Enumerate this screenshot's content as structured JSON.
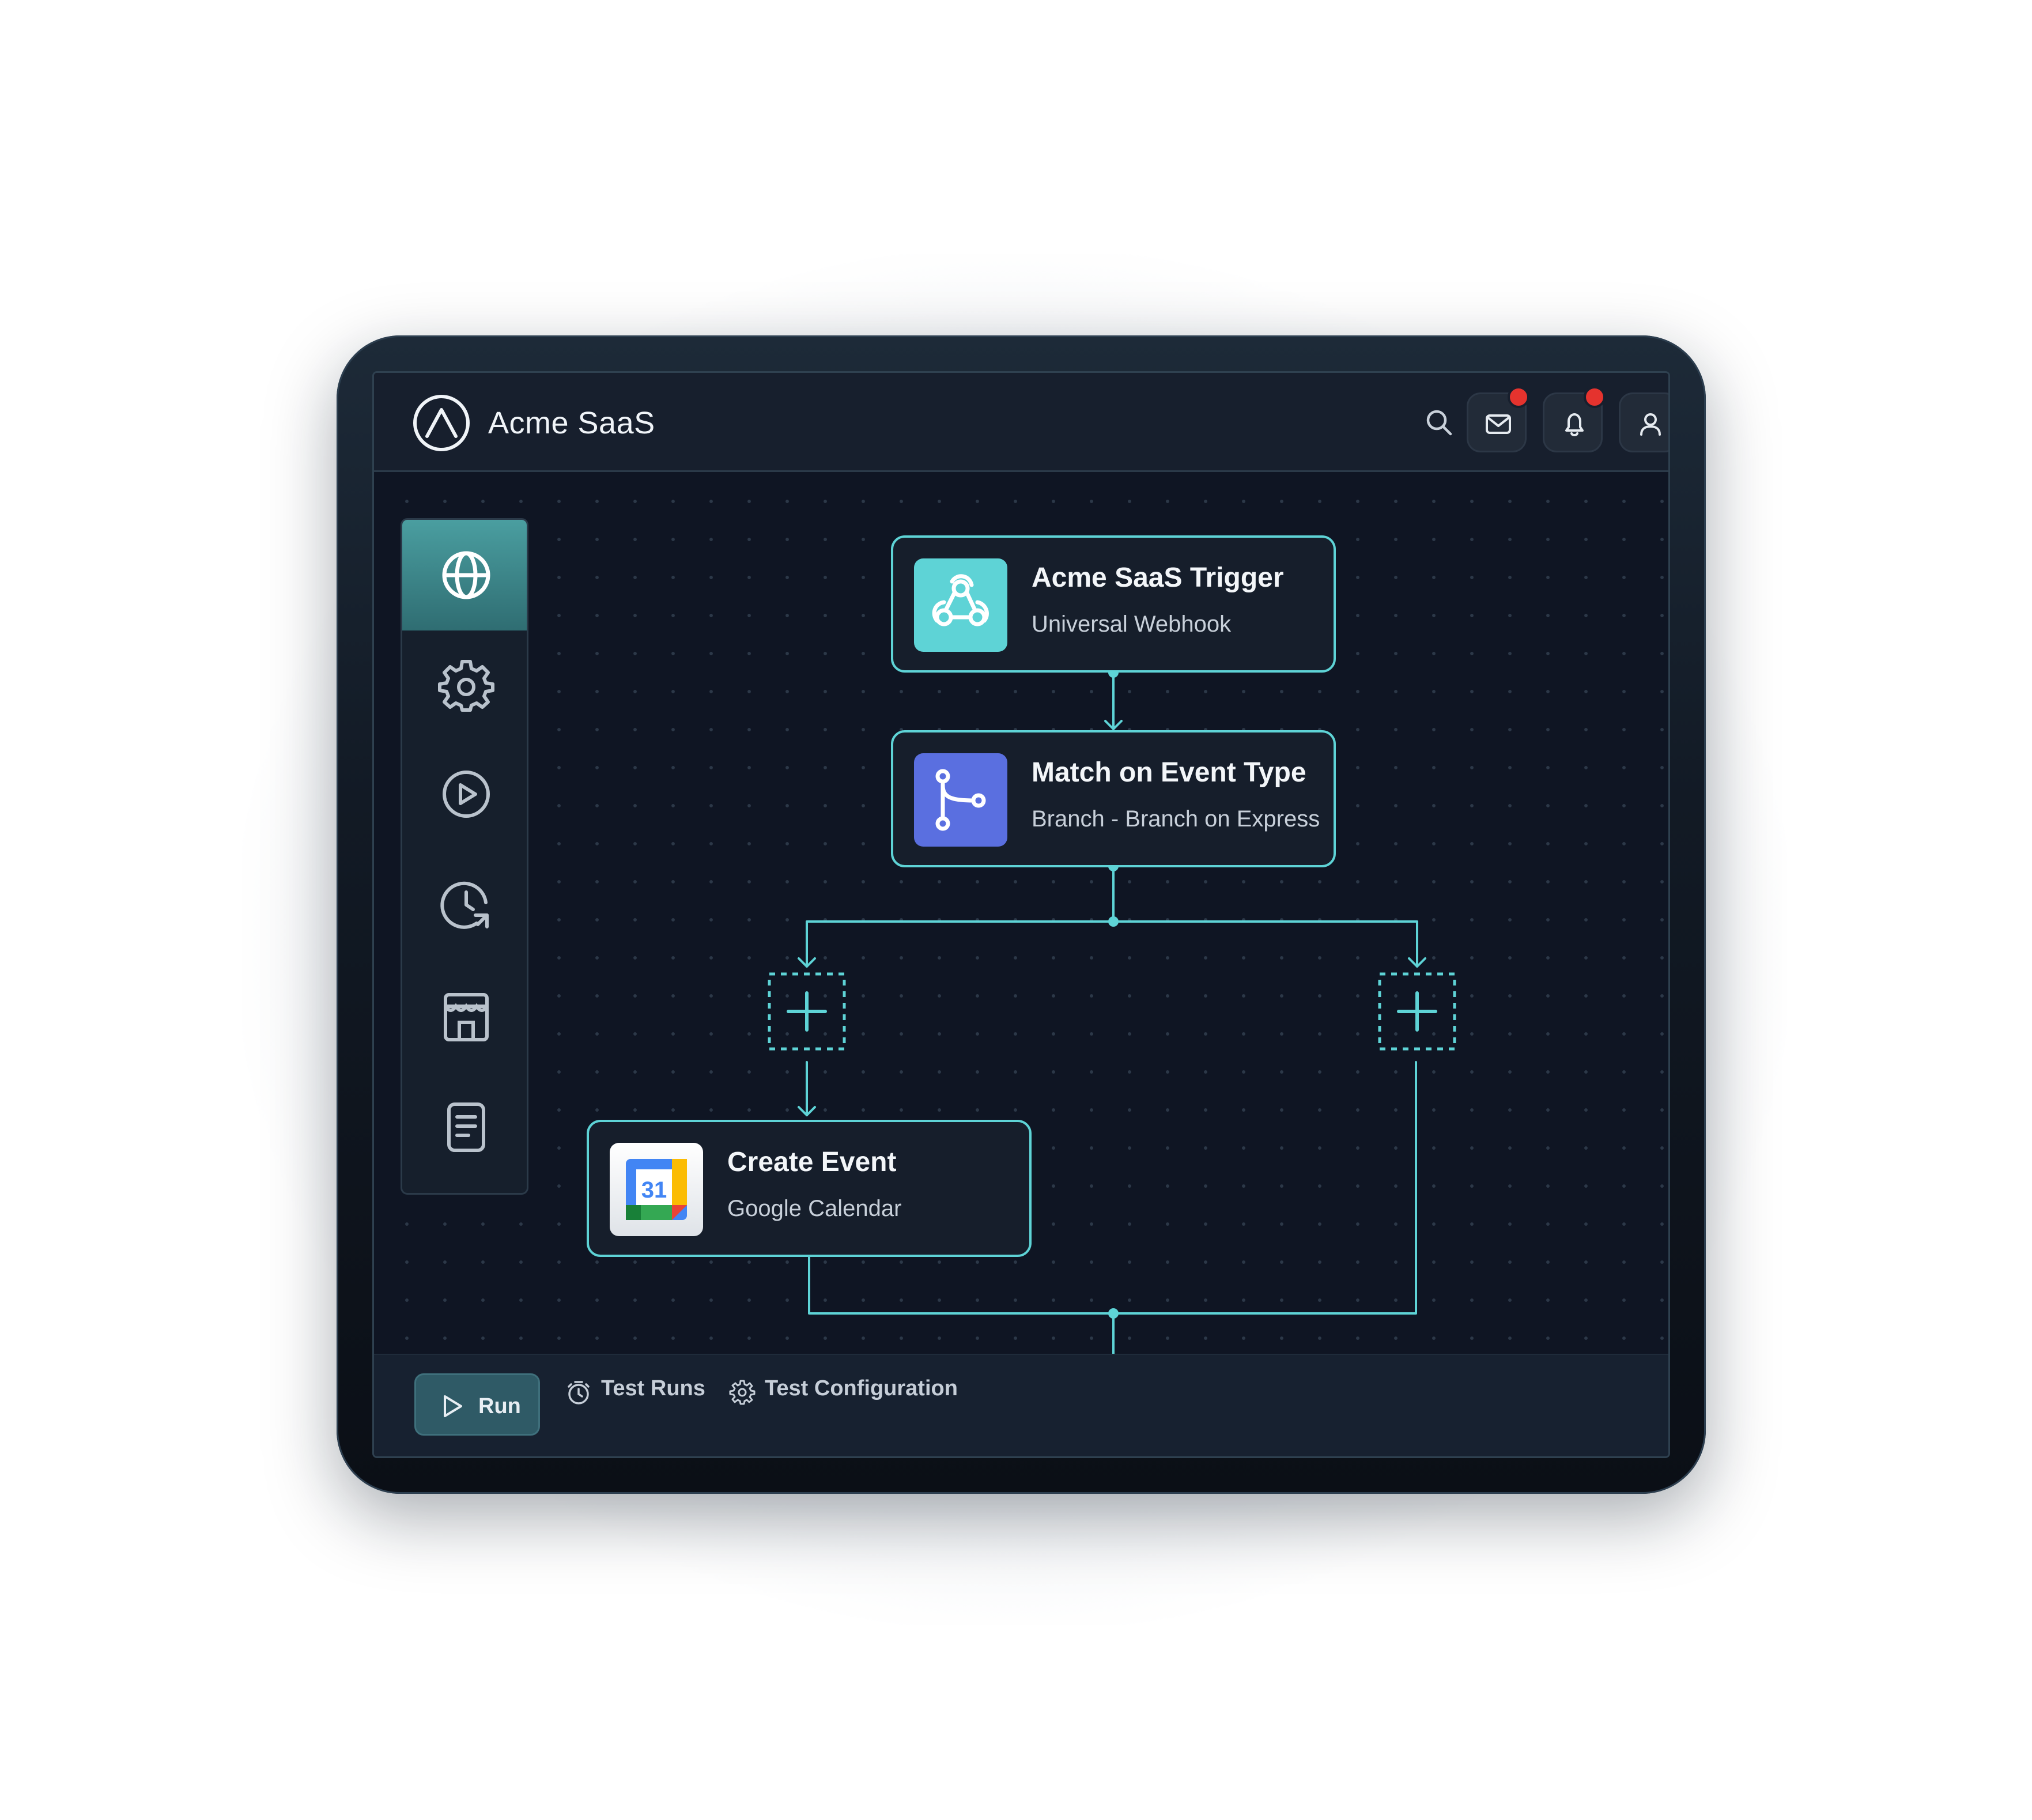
{
  "app": {
    "title": "Acme SaaS",
    "brand_color": "#5ed3d6"
  },
  "header": {
    "icons": [
      "search-icon",
      "mail-icon",
      "bell-icon",
      "user-icon"
    ],
    "notification_color": "#e5332e"
  },
  "sidebar": {
    "items": [
      {
        "icon": "globe-icon",
        "active": true
      },
      {
        "icon": "gear-icon",
        "active": false
      },
      {
        "icon": "play-circle-icon",
        "active": false
      },
      {
        "icon": "history-icon",
        "active": false
      },
      {
        "icon": "store-icon",
        "active": false
      },
      {
        "icon": "document-icon",
        "active": false
      }
    ]
  },
  "workflow": {
    "nodes": [
      {
        "title": "Acme SaaS Trigger",
        "subtitle": "Universal Webhook",
        "icon": "webhook-icon",
        "icon_color": "#5ed3d6"
      },
      {
        "title": "Match on Event Type",
        "subtitle": "Branch - Branch on Express",
        "icon": "branch-icon",
        "icon_color": "#5a6fe0"
      },
      {
        "title": "Create Event",
        "subtitle": "Google Calendar",
        "icon": "google-calendar-icon",
        "calendar_day": "31"
      }
    ],
    "connector_color": "#5ed3d6"
  },
  "footer": {
    "run_label": "Run",
    "test_runs_label": "Test Runs",
    "test_config_label": "Test Configuration"
  }
}
